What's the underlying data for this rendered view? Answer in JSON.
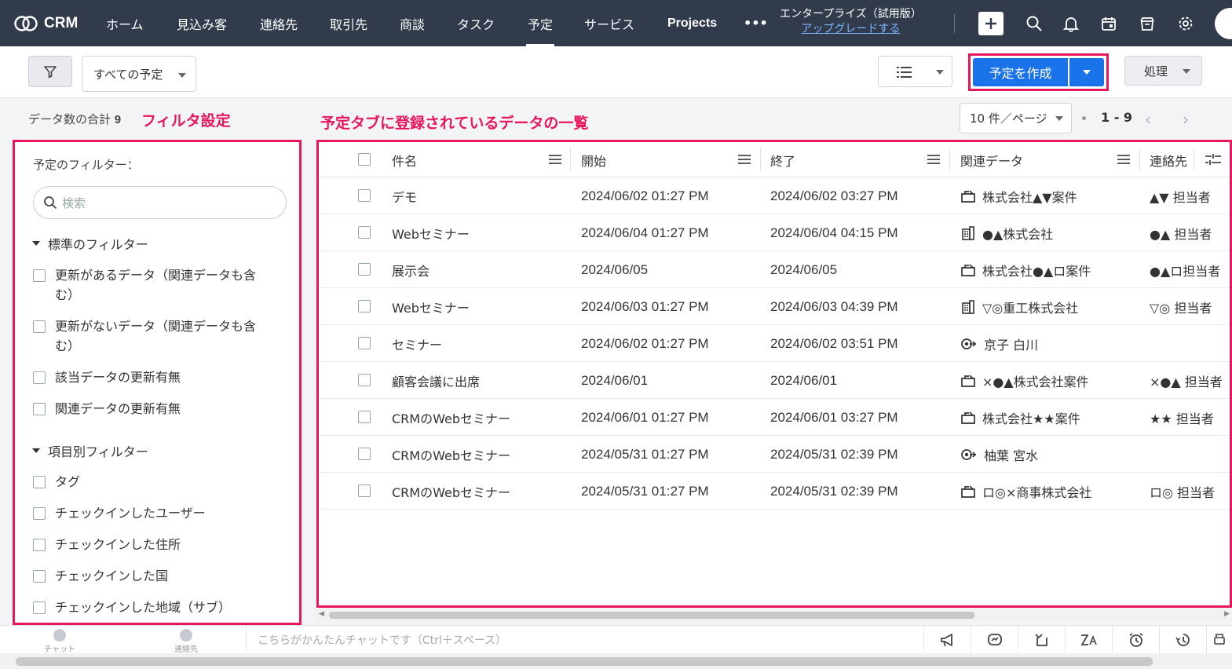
{
  "app": {
    "name": "CRM"
  },
  "nav": {
    "items": [
      "ホーム",
      "見込み客",
      "連絡先",
      "取引先",
      "商談",
      "タスク",
      "予定",
      "サービス",
      "Projects"
    ],
    "active": "予定",
    "more": "•••",
    "plan_label": "エンタープライズ（試用版）",
    "upgrade_label": "アップグレードする"
  },
  "toolbar": {
    "view_selector": "すべての予定",
    "create_button": "予定を作成",
    "action_button": "処理"
  },
  "summary": {
    "count_label": "データ数の合計",
    "count_value": "9"
  },
  "annotations": {
    "filter": "フィルタ設定",
    "list": "予定タブに登録されているデータの一覧"
  },
  "pagination": {
    "per_page": "10 件／ページ",
    "range": "1 - 9",
    "prev": "‹",
    "next": "›"
  },
  "sidebar": {
    "title": "予定のフィルター：",
    "search_placeholder": "検索",
    "standard_section": "標準のフィルター",
    "standard_items": [
      "更新があるデータ（関連データも含む）",
      "更新がないデータ（関連データも含む）",
      "該当データの更新有無",
      "関連データの更新有無"
    ],
    "field_section": "項目別フィルター",
    "field_items": [
      "タグ",
      "チェックインしたユーザー",
      "チェックインした住所",
      "チェックインした国",
      "チェックインした地域（サブ）"
    ]
  },
  "table": {
    "columns": [
      "件名",
      "開始",
      "終了",
      "関連データ",
      "連絡先"
    ],
    "rows": [
      {
        "subject": "デモ",
        "start": "2024/06/02 01:27 PM",
        "end": "2024/06/02 03:27 PM",
        "related_icon": "deal-icon",
        "related": "株式会社▲▼案件",
        "contact": "▲▼ 担当者"
      },
      {
        "subject": "Webセミナー",
        "start": "2024/06/04 01:27 PM",
        "end": "2024/06/04 04:15 PM",
        "related_icon": "building-icon",
        "related": "●▲株式会社",
        "contact": "●▲ 担当者"
      },
      {
        "subject": "展示会",
        "start": "2024/06/05",
        "end": "2024/06/05",
        "related_icon": "deal-icon",
        "related": "株式会社●▲ロ案件",
        "contact": "●▲ロ担当者"
      },
      {
        "subject": "Webセミナー",
        "start": "2024/06/03 01:27 PM",
        "end": "2024/06/03 04:39 PM",
        "related_icon": "building-icon",
        "related": "▽◎重工株式会社",
        "contact": "▽◎ 担当者"
      },
      {
        "subject": "セミナー",
        "start": "2024/06/02 01:27 PM",
        "end": "2024/06/02 03:51 PM",
        "related_icon": "lead-icon",
        "related": "京子 白川",
        "contact": ""
      },
      {
        "subject": "顧客会議に出席",
        "start": "2024/06/01",
        "end": "2024/06/01",
        "related_icon": "deal-icon",
        "related": "×●▲株式会社案件",
        "contact": "×●▲ 担当者"
      },
      {
        "subject": "CRMのWebセミナー",
        "start": "2024/06/01 01:27 PM",
        "end": "2024/06/01 03:27 PM",
        "related_icon": "deal-icon",
        "related": "株式会社★★案件",
        "contact": "★★ 担当者"
      },
      {
        "subject": "CRMのWebセミナー",
        "start": "2024/05/31 01:27 PM",
        "end": "2024/05/31 02:39 PM",
        "related_icon": "lead-icon",
        "related": "柚葉 宮水",
        "contact": ""
      },
      {
        "subject": "CRMのWebセミナー",
        "start": "2024/05/31 01:27 PM",
        "end": "2024/05/31 02:39 PM",
        "related_icon": "deal-icon",
        "related": "ロ◎×商事株式会社",
        "contact": "ロ◎ 担当者"
      }
    ]
  },
  "footer": {
    "chat_label": "チャット",
    "contacts_label": "連絡先",
    "chat_placeholder": "こちらがかんたんチャットです（Ctrl＋スペース）"
  },
  "colors": {
    "nav_bg": "#313b4c",
    "primary": "#1a73e8",
    "highlight": "#e8175d"
  }
}
